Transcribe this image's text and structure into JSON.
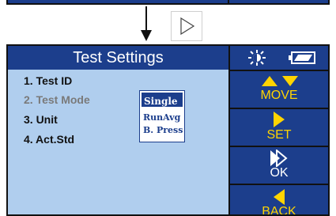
{
  "screen": {
    "title": "Test Settings",
    "menu": [
      {
        "label": "1. Test ID",
        "state": "normal"
      },
      {
        "label": "2. Test Mode",
        "state": "active"
      },
      {
        "label": "3. Unit",
        "state": "normal"
      },
      {
        "label": "4. Act.Std",
        "state": "normal"
      }
    ],
    "dropdown": {
      "selected": "Single",
      "options": [
        "RunAvg",
        "B. Press"
      ]
    }
  },
  "side_panel": {
    "icons": [
      "brightness-icon",
      "battery-icon"
    ],
    "buttons": [
      {
        "label": "MOVE",
        "icon": "up-down-arrows-icon"
      },
      {
        "label": "SET",
        "icon": "right-arrow-icon"
      },
      {
        "label": "OK",
        "icon": "double-right-arrow-icon"
      },
      {
        "label": "BACK",
        "icon": "left-arrow-icon"
      }
    ]
  },
  "colors": {
    "device_blue": "#1c3e8c",
    "screen_bg": "#b0ceee",
    "accent_yellow": "#ffd400"
  }
}
